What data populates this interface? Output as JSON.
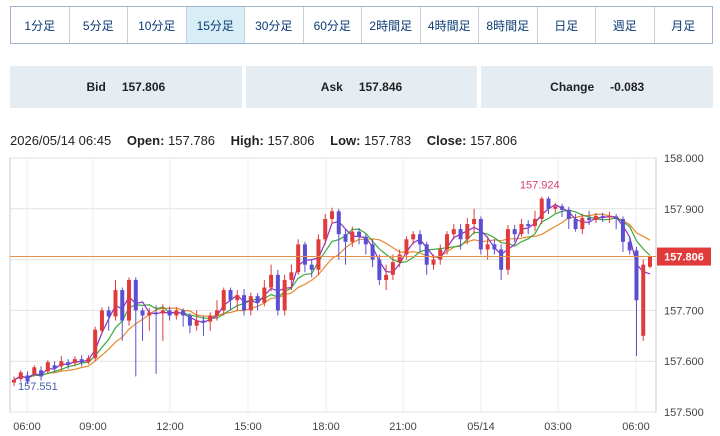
{
  "tabs": [
    "1分足",
    "5分足",
    "10分足",
    "15分足",
    "30分足",
    "60分足",
    "2時間足",
    "4時間足",
    "8時間足",
    "日足",
    "週足",
    "月足"
  ],
  "active_tab": "15分足",
  "quotes": {
    "bid_label": "Bid",
    "bid_value": "157.806",
    "ask_label": "Ask",
    "ask_value": "157.846",
    "change_label": "Change",
    "change_value": "-0.083"
  },
  "ohlc": {
    "datetime": "2026/05/14 06:45",
    "open_label": "Open:",
    "open": "157.786",
    "high_label": "High:",
    "high": "157.806",
    "low_label": "Low:",
    "low": "157.783",
    "close_label": "Close:",
    "close": "157.806"
  },
  "chart_data": {
    "type": "candlestick",
    "y_ticks": [
      "158.000",
      "157.900",
      "157.800",
      "157.700",
      "157.600",
      "157.500"
    ],
    "ylim": [
      157.5,
      158.0
    ],
    "x_ticks": [
      "06:00",
      "09:00",
      "12:00",
      "15:00",
      "18:00",
      "21:00",
      "05/14",
      "03:00",
      "06:00"
    ],
    "current_price": "157.806",
    "high_annotation": "157.924",
    "low_annotation": "157.551",
    "colors": {
      "up": "#e03a3a",
      "down": "#5a4fd0",
      "ma_short": "#8a2fc8",
      "ma_mid": "#3caa3c",
      "ma_long": "#e68a2e",
      "price_line": "#e8904a",
      "price_tag": "#e03a3a"
    },
    "candles": [
      [
        157.558,
        157.563,
        157.551,
        157.57
      ],
      [
        157.565,
        157.578,
        157.56,
        157.582
      ],
      [
        157.572,
        157.56,
        157.555,
        157.58
      ],
      [
        157.575,
        157.588,
        157.57,
        157.592
      ],
      [
        157.582,
        157.57,
        157.562,
        157.59
      ],
      [
        157.58,
        157.598,
        157.575,
        157.602
      ],
      [
        157.592,
        157.586,
        157.578,
        157.6
      ],
      [
        157.59,
        157.6,
        157.582,
        157.61
      ],
      [
        157.598,
        157.594,
        157.585,
        157.604
      ],
      [
        157.596,
        157.604,
        157.59,
        157.61
      ],
      [
        157.604,
        157.598,
        157.59,
        157.612
      ],
      [
        157.598,
        157.606,
        157.594,
        157.612
      ],
      [
        157.606,
        157.662,
        157.6,
        157.668
      ],
      [
        157.66,
        157.7,
        157.655,
        157.706
      ],
      [
        157.7,
        157.688,
        157.66,
        157.708
      ],
      [
        157.688,
        157.74,
        157.68,
        157.76
      ],
      [
        157.74,
        157.68,
        157.64,
        157.745
      ],
      [
        157.68,
        157.76,
        157.67,
        157.765
      ],
      [
        157.76,
        157.7,
        157.57,
        157.765
      ],
      [
        157.7,
        157.69,
        157.64,
        157.705
      ],
      [
        157.69,
        157.696,
        157.66,
        157.705
      ],
      [
        157.696,
        157.694,
        157.575,
        157.71
      ],
      [
        157.694,
        157.7,
        157.64,
        157.712
      ],
      [
        157.7,
        157.69,
        157.68,
        157.708
      ],
      [
        157.69,
        157.7,
        157.682,
        157.706
      ],
      [
        157.7,
        157.69,
        157.668,
        157.704
      ],
      [
        157.69,
        157.67,
        157.655,
        157.695
      ],
      [
        157.67,
        157.68,
        157.66,
        157.7
      ],
      [
        157.68,
        157.678,
        157.65,
        157.69
      ],
      [
        157.678,
        157.69,
        157.66,
        157.696
      ],
      [
        157.69,
        157.7,
        157.68,
        157.72
      ],
      [
        157.7,
        157.74,
        157.69,
        157.745
      ],
      [
        157.74,
        157.72,
        157.7,
        157.745
      ],
      [
        157.72,
        157.73,
        157.7,
        157.74
      ],
      [
        157.73,
        157.7,
        157.69,
        157.742
      ],
      [
        157.7,
        157.728,
        157.69,
        157.735
      ],
      [
        157.728,
        157.715,
        157.7,
        157.734
      ],
      [
        157.715,
        157.745,
        157.708,
        157.76
      ],
      [
        157.745,
        157.77,
        157.738,
        157.79
      ],
      [
        157.77,
        157.7,
        157.69,
        157.78
      ],
      [
        157.7,
        157.76,
        157.69,
        157.77
      ],
      [
        157.76,
        157.775,
        157.74,
        157.79
      ],
      [
        157.775,
        157.83,
        157.77,
        157.84
      ],
      [
        157.83,
        157.79,
        157.775,
        157.835
      ],
      [
        157.79,
        157.78,
        157.765,
        157.8
      ],
      [
        157.78,
        157.84,
        157.77,
        157.85
      ],
      [
        157.84,
        157.88,
        157.83,
        157.89
      ],
      [
        157.88,
        157.895,
        157.87,
        157.902
      ],
      [
        157.895,
        157.85,
        157.8,
        157.9
      ],
      [
        157.85,
        157.835,
        157.79,
        157.86
      ],
      [
        157.835,
        157.855,
        157.825,
        157.865
      ],
      [
        157.855,
        157.845,
        157.83,
        157.862
      ],
      [
        157.845,
        157.83,
        157.81,
        157.85
      ],
      [
        157.83,
        157.8,
        157.785,
        157.84
      ],
      [
        157.8,
        157.76,
        157.75,
        157.81
      ],
      [
        157.76,
        157.77,
        157.74,
        157.79
      ],
      [
        157.77,
        157.795,
        157.76,
        157.81
      ],
      [
        157.795,
        157.81,
        157.785,
        157.82
      ],
      [
        157.81,
        157.84,
        157.8,
        157.846
      ],
      [
        157.84,
        157.85,
        157.83,
        157.856
      ],
      [
        157.85,
        157.83,
        157.815,
        157.858
      ],
      [
        157.83,
        157.79,
        157.77,
        157.835
      ],
      [
        157.79,
        157.8,
        157.78,
        157.81
      ],
      [
        157.8,
        157.82,
        157.79,
        157.83
      ],
      [
        157.82,
        157.85,
        157.81,
        157.856
      ],
      [
        157.85,
        157.86,
        157.84,
        157.87
      ],
      [
        157.86,
        157.84,
        157.82,
        157.87
      ],
      [
        157.84,
        157.87,
        157.83,
        157.882
      ],
      [
        157.87,
        157.88,
        157.85,
        157.9
      ],
      [
        157.88,
        157.82,
        157.81,
        157.885
      ],
      [
        157.82,
        157.83,
        157.8,
        157.846
      ],
      [
        157.83,
        157.82,
        157.81,
        157.84
      ],
      [
        157.82,
        157.78,
        157.76,
        157.83
      ],
      [
        157.78,
        157.86,
        157.77,
        157.868
      ],
      [
        157.86,
        157.85,
        157.835,
        157.868
      ],
      [
        157.85,
        157.87,
        157.845,
        157.88
      ],
      [
        157.87,
        157.866,
        157.85,
        157.878
      ],
      [
        157.866,
        157.88,
        157.856,
        157.896
      ],
      [
        157.88,
        157.92,
        157.87,
        157.924
      ],
      [
        157.92,
        157.9,
        157.89,
        157.924
      ],
      [
        157.9,
        157.905,
        157.892,
        157.912
      ],
      [
        157.905,
        157.898,
        157.884,
        157.91
      ],
      [
        157.898,
        157.88,
        157.86,
        157.904
      ],
      [
        157.88,
        157.86,
        157.855,
        157.89
      ],
      [
        157.86,
        157.882,
        157.85,
        157.89
      ],
      [
        157.882,
        157.878,
        157.868,
        157.896
      ],
      [
        157.878,
        157.886,
        157.872,
        157.892
      ],
      [
        157.886,
        157.884,
        157.874,
        157.892
      ],
      [
        157.884,
        157.885,
        157.872,
        157.894
      ],
      [
        157.885,
        157.88,
        157.86,
        157.89
      ],
      [
        157.88,
        157.835,
        157.815,
        157.885
      ],
      [
        157.835,
        157.818,
        157.81,
        157.845
      ],
      [
        157.818,
        157.72,
        157.61,
        157.825
      ],
      [
        157.65,
        157.79,
        157.64,
        157.8
      ],
      [
        157.786,
        157.806,
        157.783,
        157.806
      ]
    ]
  }
}
